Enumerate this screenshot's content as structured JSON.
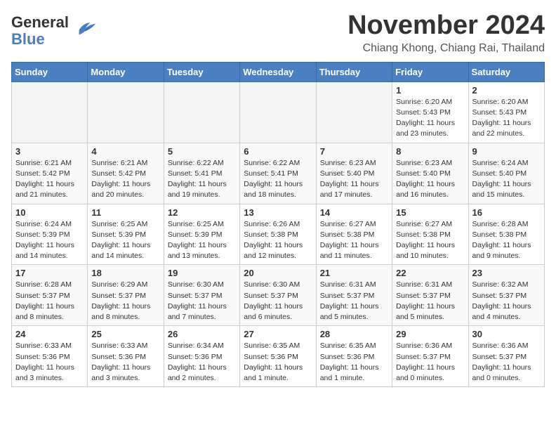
{
  "header": {
    "logo_general": "General",
    "logo_blue": "Blue",
    "month_title": "November 2024",
    "location": "Chiang Khong, Chiang Rai, Thailand"
  },
  "days_of_week": [
    "Sunday",
    "Monday",
    "Tuesday",
    "Wednesday",
    "Thursday",
    "Friday",
    "Saturday"
  ],
  "weeks": [
    [
      {
        "day": "",
        "info": ""
      },
      {
        "day": "",
        "info": ""
      },
      {
        "day": "",
        "info": ""
      },
      {
        "day": "",
        "info": ""
      },
      {
        "day": "",
        "info": ""
      },
      {
        "day": "1",
        "info": "Sunrise: 6:20 AM\nSunset: 5:43 PM\nDaylight: 11 hours and 23 minutes."
      },
      {
        "day": "2",
        "info": "Sunrise: 6:20 AM\nSunset: 5:43 PM\nDaylight: 11 hours and 22 minutes."
      }
    ],
    [
      {
        "day": "3",
        "info": "Sunrise: 6:21 AM\nSunset: 5:42 PM\nDaylight: 11 hours and 21 minutes."
      },
      {
        "day": "4",
        "info": "Sunrise: 6:21 AM\nSunset: 5:42 PM\nDaylight: 11 hours and 20 minutes."
      },
      {
        "day": "5",
        "info": "Sunrise: 6:22 AM\nSunset: 5:41 PM\nDaylight: 11 hours and 19 minutes."
      },
      {
        "day": "6",
        "info": "Sunrise: 6:22 AM\nSunset: 5:41 PM\nDaylight: 11 hours and 18 minutes."
      },
      {
        "day": "7",
        "info": "Sunrise: 6:23 AM\nSunset: 5:40 PM\nDaylight: 11 hours and 17 minutes."
      },
      {
        "day": "8",
        "info": "Sunrise: 6:23 AM\nSunset: 5:40 PM\nDaylight: 11 hours and 16 minutes."
      },
      {
        "day": "9",
        "info": "Sunrise: 6:24 AM\nSunset: 5:40 PM\nDaylight: 11 hours and 15 minutes."
      }
    ],
    [
      {
        "day": "10",
        "info": "Sunrise: 6:24 AM\nSunset: 5:39 PM\nDaylight: 11 hours and 14 minutes."
      },
      {
        "day": "11",
        "info": "Sunrise: 6:25 AM\nSunset: 5:39 PM\nDaylight: 11 hours and 14 minutes."
      },
      {
        "day": "12",
        "info": "Sunrise: 6:25 AM\nSunset: 5:39 PM\nDaylight: 11 hours and 13 minutes."
      },
      {
        "day": "13",
        "info": "Sunrise: 6:26 AM\nSunset: 5:38 PM\nDaylight: 11 hours and 12 minutes."
      },
      {
        "day": "14",
        "info": "Sunrise: 6:27 AM\nSunset: 5:38 PM\nDaylight: 11 hours and 11 minutes."
      },
      {
        "day": "15",
        "info": "Sunrise: 6:27 AM\nSunset: 5:38 PM\nDaylight: 11 hours and 10 minutes."
      },
      {
        "day": "16",
        "info": "Sunrise: 6:28 AM\nSunset: 5:38 PM\nDaylight: 11 hours and 9 minutes."
      }
    ],
    [
      {
        "day": "17",
        "info": "Sunrise: 6:28 AM\nSunset: 5:37 PM\nDaylight: 11 hours and 8 minutes."
      },
      {
        "day": "18",
        "info": "Sunrise: 6:29 AM\nSunset: 5:37 PM\nDaylight: 11 hours and 8 minutes."
      },
      {
        "day": "19",
        "info": "Sunrise: 6:30 AM\nSunset: 5:37 PM\nDaylight: 11 hours and 7 minutes."
      },
      {
        "day": "20",
        "info": "Sunrise: 6:30 AM\nSunset: 5:37 PM\nDaylight: 11 hours and 6 minutes."
      },
      {
        "day": "21",
        "info": "Sunrise: 6:31 AM\nSunset: 5:37 PM\nDaylight: 11 hours and 5 minutes."
      },
      {
        "day": "22",
        "info": "Sunrise: 6:31 AM\nSunset: 5:37 PM\nDaylight: 11 hours and 5 minutes."
      },
      {
        "day": "23",
        "info": "Sunrise: 6:32 AM\nSunset: 5:37 PM\nDaylight: 11 hours and 4 minutes."
      }
    ],
    [
      {
        "day": "24",
        "info": "Sunrise: 6:33 AM\nSunset: 5:36 PM\nDaylight: 11 hours and 3 minutes."
      },
      {
        "day": "25",
        "info": "Sunrise: 6:33 AM\nSunset: 5:36 PM\nDaylight: 11 hours and 3 minutes."
      },
      {
        "day": "26",
        "info": "Sunrise: 6:34 AM\nSunset: 5:36 PM\nDaylight: 11 hours and 2 minutes."
      },
      {
        "day": "27",
        "info": "Sunrise: 6:35 AM\nSunset: 5:36 PM\nDaylight: 11 hours and 1 minute."
      },
      {
        "day": "28",
        "info": "Sunrise: 6:35 AM\nSunset: 5:36 PM\nDaylight: 11 hours and 1 minute."
      },
      {
        "day": "29",
        "info": "Sunrise: 6:36 AM\nSunset: 5:37 PM\nDaylight: 11 hours and 0 minutes."
      },
      {
        "day": "30",
        "info": "Sunrise: 6:36 AM\nSunset: 5:37 PM\nDaylight: 11 hours and 0 minutes."
      }
    ]
  ]
}
